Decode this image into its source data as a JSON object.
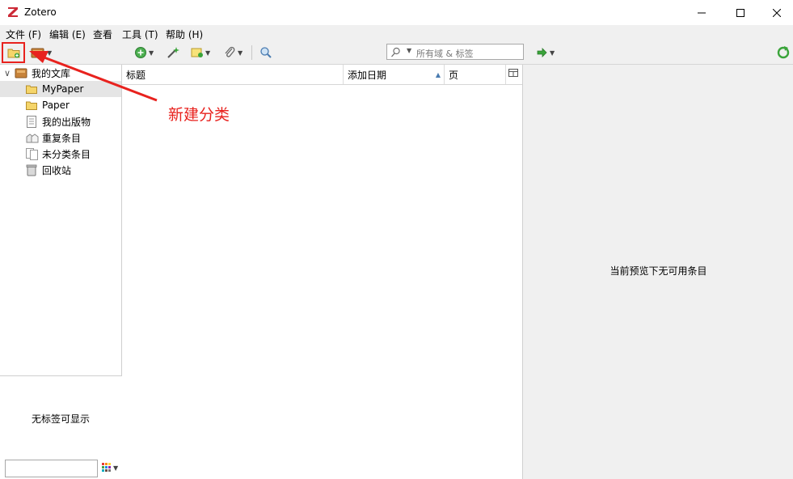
{
  "window": {
    "title": "Zotero",
    "logo_letter": "Z",
    "controls": {
      "minimize": "—",
      "maximize": "☐",
      "close": "✕"
    }
  },
  "menu": [
    {
      "label": "文件 (F)"
    },
    {
      "label": "编辑 (E)"
    },
    {
      "label": "查看"
    },
    {
      "label": "工具 (T)"
    },
    {
      "label": "帮助 (H)"
    }
  ],
  "toolbar": {
    "search_placeholder": "所有域 & 标签",
    "icons": [
      "new-collection-icon",
      "new-library-icon",
      "new-item-icon",
      "magic-wand-icon",
      "new-note-icon",
      "attachment-icon",
      "advanced-search-icon",
      "locate-icon",
      "sync-icon"
    ]
  },
  "library_tree": {
    "root_label": "我的文库",
    "items": [
      {
        "label": "MyPaper",
        "icon": "folder-icon",
        "selected": true
      },
      {
        "label": "Paper",
        "icon": "folder-icon",
        "selected": false
      },
      {
        "label": "我的出版物",
        "icon": "publications-icon",
        "selected": false
      },
      {
        "label": "重复条目",
        "icon": "duplicates-icon",
        "selected": false
      },
      {
        "label": "未分类条目",
        "icon": "unfiled-icon",
        "selected": false
      },
      {
        "label": "回收站",
        "icon": "trash-icon",
        "selected": false
      }
    ]
  },
  "tag_selector": {
    "empty_text": "无标签可显示",
    "filter_value": ""
  },
  "items_table": {
    "columns": [
      "标题",
      "添加日期",
      "页"
    ],
    "sort_indicator": "▲",
    "rows": []
  },
  "item_pane": {
    "empty_text": "当前预览下无可用条目"
  },
  "annotation": {
    "label": "新建分类",
    "color": "#e8221e"
  },
  "colors": {
    "accent_red": "#e8221e",
    "toolbar_bg": "#f0f0f0",
    "selection_bg": "#e5e5e5",
    "folder_yellow": "#f5c542"
  }
}
